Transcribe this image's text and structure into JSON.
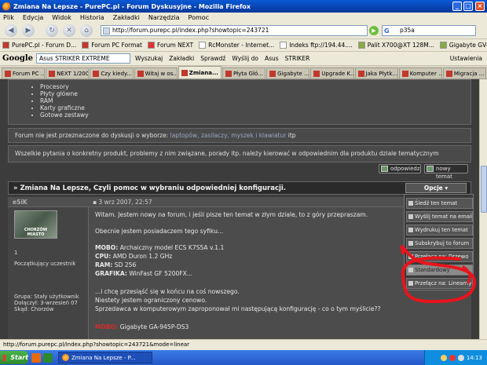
{
  "window": {
    "title": "Zmiana Na Lepsze - PurePC.pl - Forum Dyskusyjne - Mozilla Firefox",
    "controls": [
      "_",
      "□",
      "×"
    ]
  },
  "menu": [
    "Plik",
    "Edycja",
    "Widok",
    "Historia",
    "Zakładki",
    "Narzędzia",
    "Pomoc"
  ],
  "nav": {
    "url": "http://forum.purepc.pl/index.php?showtopic=243721",
    "search_value": "p35a"
  },
  "bookmarks": [
    "PurePC.pl - Forum D...",
    "Forum PC Format",
    "Forum NEXT",
    "RcMonster - Internet...",
    "Indeks ftp://194.44....",
    "Palit X700@XT 128M...",
    "Gigabyte GV-NX66 1..."
  ],
  "google_toolbar": {
    "logo": "Google",
    "search_value": "Asus STRIKER EXTREME",
    "items": [
      "Wyszukaj",
      "Zakładki",
      "Sprawdź",
      "Wyślij do",
      "Asus",
      "STRIKER",
      "Ustawienia"
    ]
  },
  "tabs": [
    {
      "label": "Forum PC ...",
      "active": false
    },
    {
      "label": "NEXT 1/2007",
      "active": false
    },
    {
      "label": "Czy kiedy...",
      "active": false
    },
    {
      "label": "Witaj w os...",
      "active": false
    },
    {
      "label": "Zmiana...",
      "active": true
    },
    {
      "label": "Płyta Głó...",
      "active": false
    },
    {
      "label": "Gigabyte ...",
      "active": false
    },
    {
      "label": "Upgrade K...",
      "active": false
    },
    {
      "label": "Jaka Płytk...",
      "active": false
    },
    {
      "label": "Komputer ...",
      "active": false
    },
    {
      "label": "Migracja ...",
      "active": false
    }
  ],
  "forum": {
    "categories": [
      "Procesory",
      "Płyty główne",
      "RAM",
      "Karty graficzne",
      "Gotowe zestawy"
    ],
    "note1_prefix": "Forum nie jest przeznaczone do dyskusji o wyborze:",
    "note1_links": "laptopów, zasilaczy, myszek i klawiatur",
    "note1_suffix": "itp",
    "note2": "Wszelkie pytania o konkretny produkt, problemy z nim związane, porady itp. należy kierować w odpowiednim dla produktu dziale tematycznym",
    "reply_button": "odpowiedz",
    "new_topic_button": "nowy temat",
    "thread_title": "» Zmiana Na Lepsze, Czyli pomoc w wybraniu odpowiedniej konfiguracji.",
    "options_button": "Opcje ▾",
    "post": {
      "author": "eSiK",
      "date": "3 wrz 2007, 22:57",
      "avatar_caption": "CHORZÓW   MIASTO",
      "rank_number": "1",
      "rank": "Początkujący uczestnik",
      "group": "Grupa: Stały użytkownik",
      "joined": "Dołączył: 3-wrzesień 07",
      "from": "Skąd: Chorzów",
      "greeting": "Witam. Jestem nowy na forum, i jeśli pisze ten temat w złym dziale, to z góry przepraszam.",
      "intro": "Obecnie jestem posiadaczem tego syfiku...",
      "specs": [
        {
          "label": "MOBO:",
          "value": "Archaiczny model ECS K7S5A v.1.1"
        },
        {
          "label": "CPU:",
          "value": "AMD Duron 1.2 GHz"
        },
        {
          "label": "RAM:",
          "value": "SD 256"
        },
        {
          "label": "GRAFIKA:",
          "value": "WinFast GF 5200FX..."
        }
      ],
      "line1": "...i chcę przesiąść się w końcu na coś nowszego.",
      "line2": "Niestety jestem ograniczony cenowo.",
      "line3": "Sprzedawca w komputerowym zaproponował mi następującą konfigurację - co o tym myślicie??",
      "last_label": "MOBO:",
      "last_value": "Gigabyte GA-945P-DS3"
    },
    "options_menu": [
      {
        "label": "Śledź ten temat",
        "selected": false
      },
      {
        "label": "Wyślij temat na email",
        "selected": false
      },
      {
        "label": "Wydrukuj ten temat",
        "selected": false
      },
      {
        "label": "Subskrybuj to forum",
        "selected": false
      },
      {
        "label": "Przełącz na: Drzewo",
        "selected": false
      },
      {
        "label": "Standardowy",
        "selected": true
      },
      {
        "label": "Przełącz na: Linearny",
        "selected": false
      }
    ]
  },
  "status": "http://forum.purepc.pl/index.php?showtopic=243721&mode=linear",
  "taskbar": {
    "start": "Start",
    "task": "Zmiana Na Lepsze - P...",
    "clock": "14:13"
  },
  "colors": {
    "page_bg": "#3c3c3c",
    "annotation": "#e8141c",
    "titlebar": "#0842b0"
  }
}
